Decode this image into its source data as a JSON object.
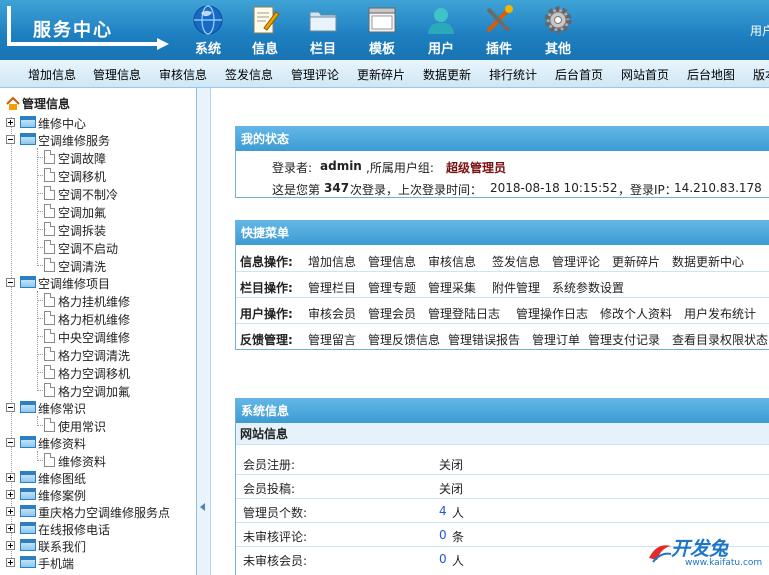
{
  "header": {
    "logo_text": "服务中心",
    "nav": [
      {
        "label": "系统",
        "icon": "globe-icon"
      },
      {
        "label": "信息",
        "icon": "document-pen-icon"
      },
      {
        "label": "栏目",
        "icon": "folder-icon"
      },
      {
        "label": "模板",
        "icon": "template-window-icon"
      },
      {
        "label": "用户",
        "icon": "user-icon"
      },
      {
        "label": "插件",
        "icon": "tools-icon"
      },
      {
        "label": "其他",
        "icon": "gear-icon"
      }
    ],
    "user_corner": "用户"
  },
  "subnav": [
    "增加信息",
    "管理信息",
    "审核信息",
    "签发信息",
    "管理评论",
    "更新碎片",
    "数据更新",
    "排行统计",
    "后台首页",
    "网站首页",
    "后台地图",
    "版本"
  ],
  "tree": {
    "title": "管理信息",
    "nodes": [
      {
        "label": "维修中心"
      },
      {
        "label": "空调维修服务",
        "children": [
          "空调故障",
          "空调移机",
          "空调不制冷",
          "空调加氟",
          "空调拆装",
          "空调不启动",
          "空调清洗"
        ]
      },
      {
        "label": "空调维修项目",
        "children": [
          "格力挂机维修",
          "格力柜机维修",
          "中央空调维修",
          "格力空调清洗",
          "格力空调移机",
          "格力空调加氟"
        ]
      },
      {
        "label": "维修常识",
        "children": [
          "使用常识"
        ]
      },
      {
        "label": "维修资料",
        "children": [
          "维修资料"
        ]
      },
      {
        "label": "维修图纸"
      },
      {
        "label": "维修案例"
      },
      {
        "label": "重庆格力空调维修服务点"
      },
      {
        "label": "在线报修电话"
      },
      {
        "label": "联系我们"
      },
      {
        "label": "手机端"
      }
    ]
  },
  "status": {
    "title": "我的状态",
    "login_label": "登录者:",
    "username": "admin",
    "group_label": ",所属用户组:",
    "group": "超级管理员",
    "count_prefix": "这是您第",
    "count": "347",
    "count_suffix": "次登录，上次登录时间：",
    "last_time": "2018-08-18 10:15:52",
    "ip_label": "，登录IP：",
    "ip": "14.210.83.178"
  },
  "quick": {
    "title": "快捷菜单",
    "rows": [
      {
        "cat": "信息操作:",
        "links": [
          "增加信息",
          "管理信息",
          "审核信息",
          "签发信息",
          "管理评论",
          "更新碎片",
          "数据更新中心"
        ]
      },
      {
        "cat": "栏目操作:",
        "links": [
          "管理栏目",
          "管理专题",
          "管理采集",
          "附件管理",
          "系统参数设置"
        ]
      },
      {
        "cat": "用户操作:",
        "links": [
          "审核会员",
          "管理会员",
          "管理登陆日志",
          "管理操作日志",
          "修改个人资料",
          "用户发布统计"
        ]
      },
      {
        "cat": "反馈管理:",
        "links": [
          "管理留言",
          "管理反馈信息",
          "管理错误报告",
          "管理订单",
          "管理支付记录",
          "查看目录权限状态"
        ]
      }
    ]
  },
  "sysinfo": {
    "title": "系统信息",
    "subhead": "网站信息",
    "rows": [
      {
        "label": "会员注册:",
        "value": "关闭",
        "unit": ""
      },
      {
        "label": "会员投稿:",
        "value": "关闭",
        "unit": ""
      },
      {
        "label": "管理员个数:",
        "value": "4",
        "unit": "人"
      },
      {
        "label": "未审核评论:",
        "value": "0",
        "unit": "条"
      },
      {
        "label": "未审核会员:",
        "value": "0",
        "unit": "人"
      }
    ]
  },
  "watermark": {
    "brand": "开发兔",
    "domain": "www.kaifatu.com"
  }
}
